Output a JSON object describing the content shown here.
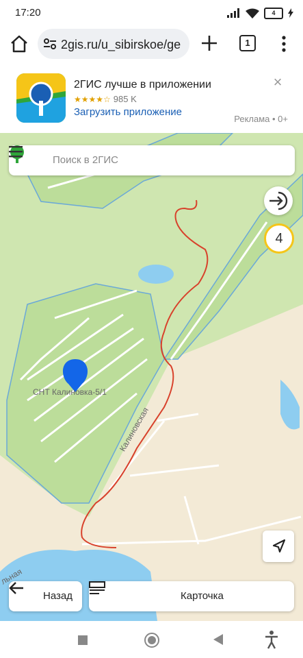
{
  "status_bar": {
    "time": "17:20",
    "battery": "4"
  },
  "browser": {
    "url": "2gis.ru/u_sibirskoe/ge",
    "tab_count": "1"
  },
  "ad": {
    "title": "2ГИС лучше в приложении",
    "rating_stars": "★★★★☆",
    "reviews": "985 K",
    "download": "Загрузить приложение",
    "label": "Реклама • 0+"
  },
  "map": {
    "search_placeholder": "Поиск в 2ГИС",
    "poi_label": "СНТ Калиновка-5/1",
    "street_label": "Калиновская",
    "street_label_2": "льная",
    "count_badge": "4"
  },
  "bottom": {
    "back_label": "Назад",
    "card_label": "Карточка"
  },
  "colors": {
    "forest": "#cfe6b0",
    "forest_dark": "#bcdd9a",
    "sand": "#f3ead6",
    "water": "#8ecdf0",
    "route": "#d8412b",
    "pin": "#1366e8"
  }
}
